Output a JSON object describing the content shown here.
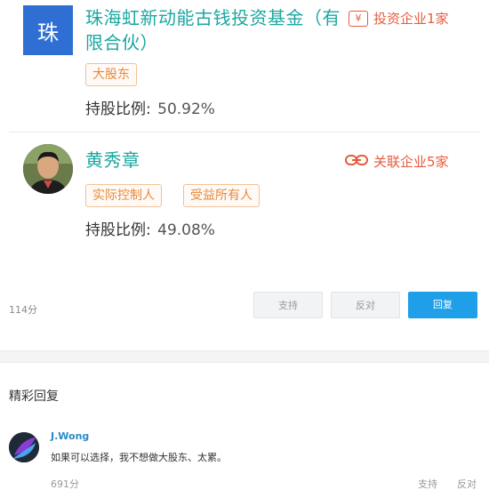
{
  "holders": [
    {
      "logo_char": "珠",
      "name": "珠海虹新动能古钱投资基金（有限合伙）",
      "tags": [
        "大股东"
      ],
      "ratio_label": "持股比例:",
      "ratio_value": "50.92%",
      "link_icon": "yen-box-icon",
      "link_text": "投资企业1家"
    },
    {
      "avatar_icon": "person-avatar",
      "name": "黄秀章",
      "tags": [
        "实际控制人",
        "受益所有人"
      ],
      "ratio_label": "持股比例:",
      "ratio_value": "49.08%",
      "link_icon": "chain-link-icon",
      "link_text": "关联企业5家"
    }
  ],
  "post": {
    "score": "114分",
    "support_label": "支持",
    "oppose_label": "反对",
    "reply_label": "回复"
  },
  "hot_replies": {
    "title": "精彩回复",
    "comments": [
      {
        "user": "J.Wong",
        "text": "如果可以选择，我不想做大股东、太累。",
        "score": "691分",
        "support_label": "支持",
        "oppose_label": "反对"
      }
    ]
  },
  "colors": {
    "name": "#1ba7a0",
    "tag_border": "#f0c29a",
    "tag_text": "#e8893c",
    "link": "#e55c3e",
    "reply_button": "#1e9fe8",
    "logo_bg": "#2f6fd4",
    "username": "#2a8ac9"
  }
}
